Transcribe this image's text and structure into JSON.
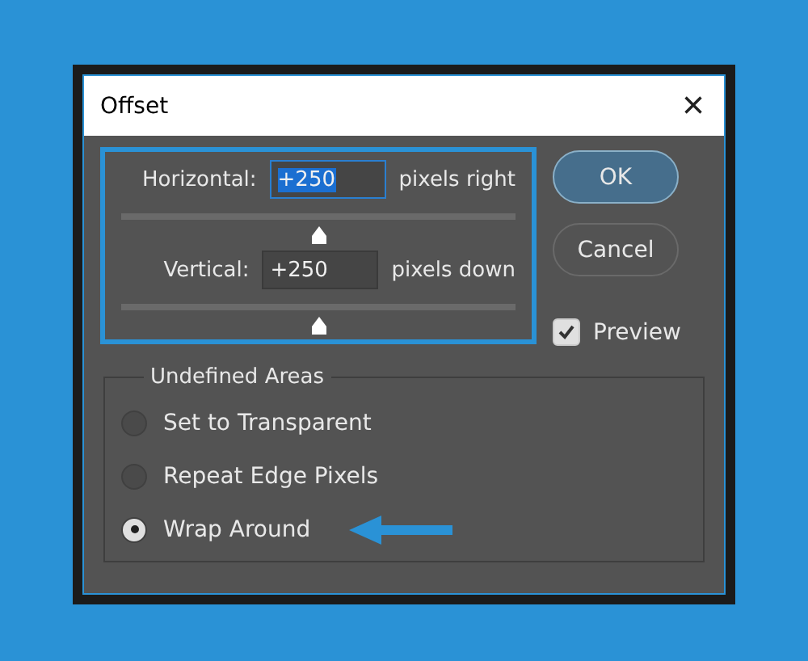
{
  "window": {
    "title": "Offset",
    "close": "×"
  },
  "offsets": [
    {
      "label": "Horizontal:",
      "value": "+250",
      "unit": "pixels right",
      "focused": true,
      "level": 0.5
    },
    {
      "label": "Vertical:",
      "value": "+250",
      "unit": "pixels down",
      "focused": false,
      "level": 0.5
    }
  ],
  "buttons": [
    {
      "label": "OK",
      "default": true
    },
    {
      "label": "Cancel",
      "default": false
    }
  ],
  "preview": {
    "label": "Preview",
    "checked": true
  },
  "undefined_areas": {
    "title": "Undefined Areas",
    "options": [
      {
        "label": "Set to Transparent",
        "selected": false,
        "pointer": false
      },
      {
        "label": "Repeat Edge Pixels",
        "selected": false,
        "pointer": false
      },
      {
        "label": "Wrap Around",
        "selected": true,
        "pointer": true
      }
    ]
  }
}
